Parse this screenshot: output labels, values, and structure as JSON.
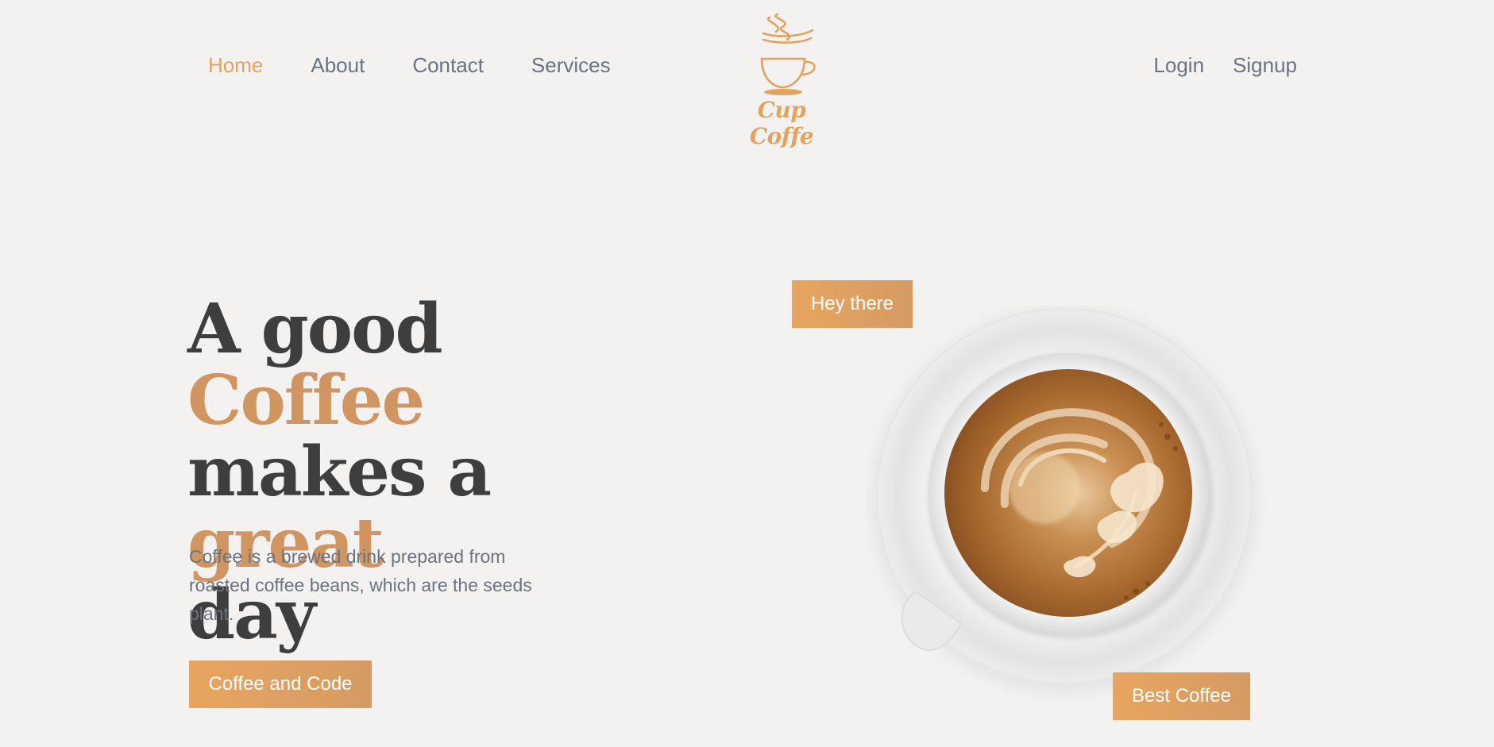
{
  "nav": {
    "left_items": [
      {
        "label": "Home",
        "active": true
      },
      {
        "label": "About",
        "active": false
      },
      {
        "label": "Contact",
        "active": false
      },
      {
        "label": "Services",
        "active": false
      }
    ],
    "right_items": [
      {
        "label": "Login"
      },
      {
        "label": "Signup"
      }
    ]
  },
  "logo": {
    "text": "Cup Coffe",
    "icon": "coffee-cup-icon"
  },
  "hero": {
    "headline_part1": "A good ",
    "headline_accent1": "Coffee",
    "headline_part2": "makes a ",
    "headline_accent2": "great",
    "headline_part3": "day",
    "description": "Coffee is a brewed drink prepared from roasted coffee beans, which are the seeds plant.",
    "cta_label": "Coffee and Code",
    "tag_top": "Hey there",
    "tag_bottom": "Best Coffee"
  },
  "colors": {
    "background": "#f3f2f1",
    "accent": "#e2a35f",
    "headline_accent": "#d09560",
    "text_dark": "#3e3e3e",
    "text_muted": "#6b7280"
  }
}
